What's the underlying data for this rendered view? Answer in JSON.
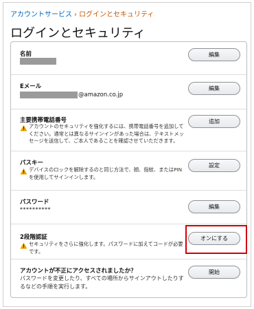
{
  "breadcrumb": {
    "parent": "アカウントサービス",
    "separator": "›",
    "current": "ログインとセキュリティ"
  },
  "page_title": "ログインとセキュリティ",
  "rows": {
    "name": {
      "label": "名前",
      "button": "編集"
    },
    "email": {
      "label": "Eメール",
      "value_suffix": "@amazon.co.jp",
      "button": "編集"
    },
    "phone": {
      "label": "主要携帯電話番号",
      "warning": "アカウントのセキュリティを強化するには、携帯電話番号を追加してください。通常とは異なるサインインがあった場合は、テキストメッセージを送信して、ご本人であることを確認させていただきます。",
      "button": "追加"
    },
    "passkey": {
      "label": "パスキー",
      "warning": "デバイスのロックを解除するのと同じ方法で、顔、指紋、またはPINを使用してサインインします。",
      "button": "設定"
    },
    "password": {
      "label": "パスワード",
      "value": "**********",
      "button": "編集"
    },
    "two_step": {
      "label": "2段階認証",
      "warning": "セキュリティをさらに強化します。パスワードに加えてコードが必要です。",
      "button": "オンにする"
    },
    "compromised": {
      "label": "アカウントが不正にアクセスされましたか？",
      "text": "パスワードを変更したり、すべての場所からサインアウトしたりするなどの手順を実行します。",
      "button": "開始"
    }
  },
  "icons": {
    "warning": "warning-triangle-icon"
  },
  "colors": {
    "link": "#0066c0",
    "breadcrumb_current": "#c45500",
    "highlight": "#d00000",
    "warning": "#e8a400"
  }
}
